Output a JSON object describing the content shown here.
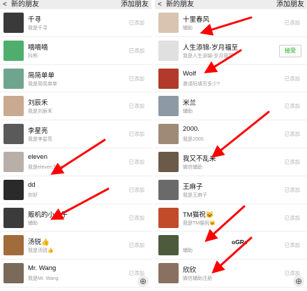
{
  "left": {
    "header": {
      "back": "<",
      "title": "新的朋友",
      "action": "添加朋友"
    },
    "rows": [
      {
        "name": "千寻",
        "sub": "我是千寻",
        "status": "已添加",
        "avatar_color": "#3a3a3a"
      },
      {
        "name": "嘀嘀嘀",
        "sub": "抖熊",
        "status": "已添加",
        "avatar_color": "#4fae6e"
      },
      {
        "name": "简简单单",
        "sub": "我是简简单单",
        "status": "已添加",
        "avatar_color": "#6fa58e"
      },
      {
        "name": "刘辰禾",
        "sub": "我是刘辰禾",
        "status": "已添加",
        "avatar_color": "#c9a98f"
      },
      {
        "name": "李星亮",
        "sub": "我是李星亮",
        "status": "已添加",
        "avatar_color": "#5a5a5a"
      },
      {
        "name": "eleven",
        "sub": "我是eleven,辅助",
        "status": "已添加",
        "avatar_color": "#b8b0a8"
      },
      {
        "name": "dd",
        "sub": "你好",
        "status": "已添加",
        "avatar_color": "#2a2a2a"
      },
      {
        "name": "贩机的小伙子",
        "sub": "辅助",
        "status": "已添加",
        "avatar_color": "#3b3b3b"
      },
      {
        "name": "汤锐👍",
        "sub": "我是汤锐👍",
        "status": "已添加",
        "avatar_color": "#a06c3c"
      },
      {
        "name": "Mr. Wang",
        "sub": "我是Mr. Wang",
        "status": "已添加",
        "avatar_color": "#7a6a5a"
      }
    ]
  },
  "right": {
    "header": {
      "back": "<",
      "title": "新的朋友",
      "action": "添加朋友"
    },
    "rows": [
      {
        "name": "十里春风",
        "sub": "辅助",
        "status": "已添加",
        "avatar_color": "#d8c4b0"
      },
      {
        "name": "人生添锦-岁月福至",
        "sub": "我是人生添锦-岁月福至",
        "status": "",
        "accept": "接受",
        "avatar_color": "#e0e0e0"
      },
      {
        "name": "Wolf",
        "sub": "邀请码填写多少?",
        "status": "已添加",
        "avatar_color": "#b33a2a"
      },
      {
        "name": "米兰",
        "sub": "辅助",
        "status": "已添加",
        "avatar_color": "#8d99a3"
      },
      {
        "name": "2000.",
        "sub": "我是2000.",
        "status": "已添加",
        "avatar_color": "#9f8a78"
      },
      {
        "name": "我又不乱来",
        "sub": "微信辅助",
        "status": "已添加",
        "avatar_color": "#6b5a4a"
      },
      {
        "name": "王麻子",
        "sub": "我是王麻子",
        "status": "已添加",
        "avatar_color": "#6a6a6a"
      },
      {
        "name": "TM猫祝🐱",
        "sub": "我是TM猫祝🐱",
        "status": "已添加",
        "avatar_color": "#c24b2a"
      },
      {
        "name": "",
        "sub": "辅助",
        "status": "已添加",
        "extra": "oGRe",
        "avatar_color": "#4e5a3e"
      },
      {
        "name": "欣欣",
        "sub": "微信辅助注册",
        "status": "已添加",
        "avatar_color": "#8a7060"
      }
    ]
  },
  "zoom_icon": "zoom-in-icon",
  "arrow_color": "#ff0000"
}
